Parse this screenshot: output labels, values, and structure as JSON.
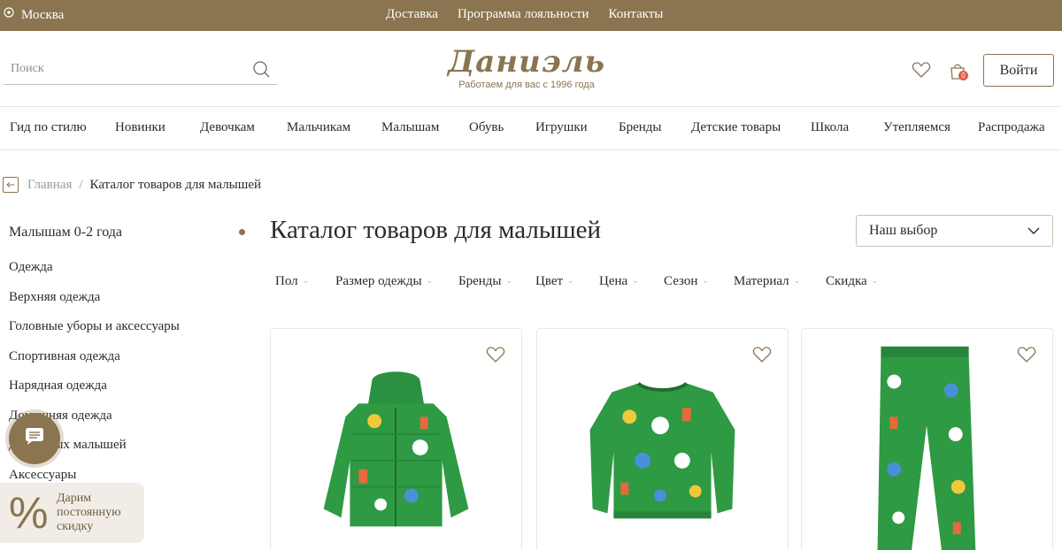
{
  "topbar": {
    "city": "Москва",
    "links": [
      "Доставка",
      "Программа лояльности",
      "Контакты"
    ]
  },
  "header": {
    "search_placeholder": "Поиск",
    "logo_name": "Даниэль",
    "logo_tagline": "Работаем для вас с 1996 года",
    "cart_count": "0",
    "login_label": "Войти"
  },
  "nav": {
    "items": [
      "Гид по стилю",
      "Новинки",
      "Девочкам",
      "Мальчикам",
      "Малышам",
      "Обувь",
      "Игрушки",
      "Бренды",
      "Детские товары",
      "Школа",
      "Утепляемся",
      "Распродажа"
    ]
  },
  "breadcrumb": {
    "home": "Главная",
    "separator": "/",
    "current": "Каталог товаров для малышей"
  },
  "sidebar": {
    "title": "Малышам 0-2 года",
    "items": [
      "Одежда",
      "Верхняя одежда",
      "Головные уборы и аксессуары",
      "Спортивная одежда",
      "Нарядная одежда",
      "Домашняя одежда",
      "Для самых малышей",
      "Аксессуары"
    ]
  },
  "promo": {
    "symbol": "%",
    "line1": "Дарим",
    "line2": "постоянную",
    "line3": "скидку"
  },
  "catalog": {
    "title": "Каталог товаров для малышей",
    "sort_value": "Наш выбор",
    "filters": [
      "Пол",
      "Размер одежды",
      "Бренды",
      "Цвет",
      "Цена",
      "Сезон",
      "Материал",
      "Скидка"
    ]
  },
  "products": [
    {
      "kind": "jacket",
      "color": "#2e9a43"
    },
    {
      "kind": "sweatshirt",
      "color": "#2e9a43"
    },
    {
      "kind": "pants",
      "color": "#2e9a43"
    }
  ],
  "colors": {
    "brand": "#8a7550",
    "badge": "#e25b4a",
    "promo_bg": "#f1ede6"
  },
  "icons": [
    "location-icon",
    "search-icon",
    "heart-icon",
    "bag-icon",
    "back-arrow-icon",
    "chevron-down-icon",
    "chat-icon",
    "percent-icon"
  ]
}
